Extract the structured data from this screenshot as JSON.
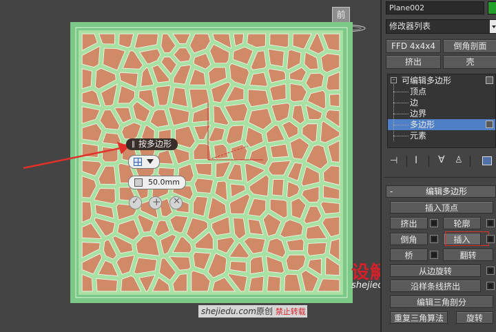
{
  "viewport": {
    "view_cube_label": "前",
    "caddy": {
      "title": "按多边形",
      "amount_value": "50.0mm"
    },
    "watermark": {
      "site": "shejiedu.com",
      "original": "原创",
      "no_repost": "禁止转载"
    },
    "logo": {
      "cn": "设解读",
      "url": "shejiedu.com"
    }
  },
  "panel": {
    "object_name": "Plane002",
    "modifier_list": "修改器列表",
    "buttons_row1": [
      "FFD 4x4x4",
      "倒角剖面"
    ],
    "buttons_row2": [
      "挤出",
      "壳"
    ],
    "stack": {
      "root": "可编辑多边形",
      "items": [
        "顶点",
        "边",
        "边界",
        "多边形",
        "元素"
      ],
      "selected_index": 3
    },
    "rollout": {
      "title": "编辑多边形",
      "collapse_symbol": "-",
      "insert_vertex": "插入顶点",
      "extrude": "挤出",
      "outline": "轮廓",
      "bevel": "倒角",
      "inset": "插入",
      "bridge": "桥",
      "flip": "翻转",
      "hinge_from_edge": "从边旋转",
      "extrude_along_spline": "沿样条线挤出",
      "edit_triangulation": "编辑三角剖分",
      "retriangulate": "重复三角算法",
      "turn": "旋转"
    }
  },
  "colors": {
    "mesh_fill": "#d08a68",
    "mesh_edges": "#a9e0a4",
    "plane_border": "#7cc987",
    "selection": "#4f7fc7",
    "arrow": "#e0312a",
    "logo_red": "#d6202a"
  }
}
